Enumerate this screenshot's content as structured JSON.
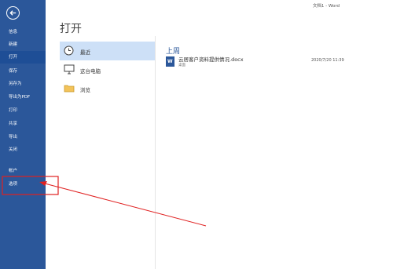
{
  "window": {
    "title": "文档1 - Word"
  },
  "sidebar": {
    "back_icon": "back-arrow-icon",
    "items": [
      {
        "label": "信息"
      },
      {
        "label": "新建"
      },
      {
        "label": "打开"
      },
      {
        "label": "保存"
      },
      {
        "label": "另存为"
      },
      {
        "label": "导出为PDF"
      },
      {
        "label": "打印"
      },
      {
        "label": "共享"
      },
      {
        "label": "导出"
      },
      {
        "label": "关闭"
      },
      {
        "label": "帐户"
      },
      {
        "label": "选项"
      }
    ]
  },
  "main": {
    "title": "打开",
    "places": [
      {
        "label": "最近",
        "icon": "clock-icon"
      },
      {
        "label": "这台电脑",
        "icon": "computer-icon"
      },
      {
        "label": "浏览",
        "icon": "folder-icon"
      }
    ],
    "section_header": "上周",
    "files": [
      {
        "name": "云居客户资料提供情况.docx",
        "path": "桌面",
        "date": "2020/7/20 11:39",
        "icon": "word-document-icon"
      }
    ]
  },
  "colors": {
    "sidebar": "#2b579a",
    "accent": "#2b579a",
    "selected": "#cde0f7",
    "annotation": "#e02020"
  }
}
